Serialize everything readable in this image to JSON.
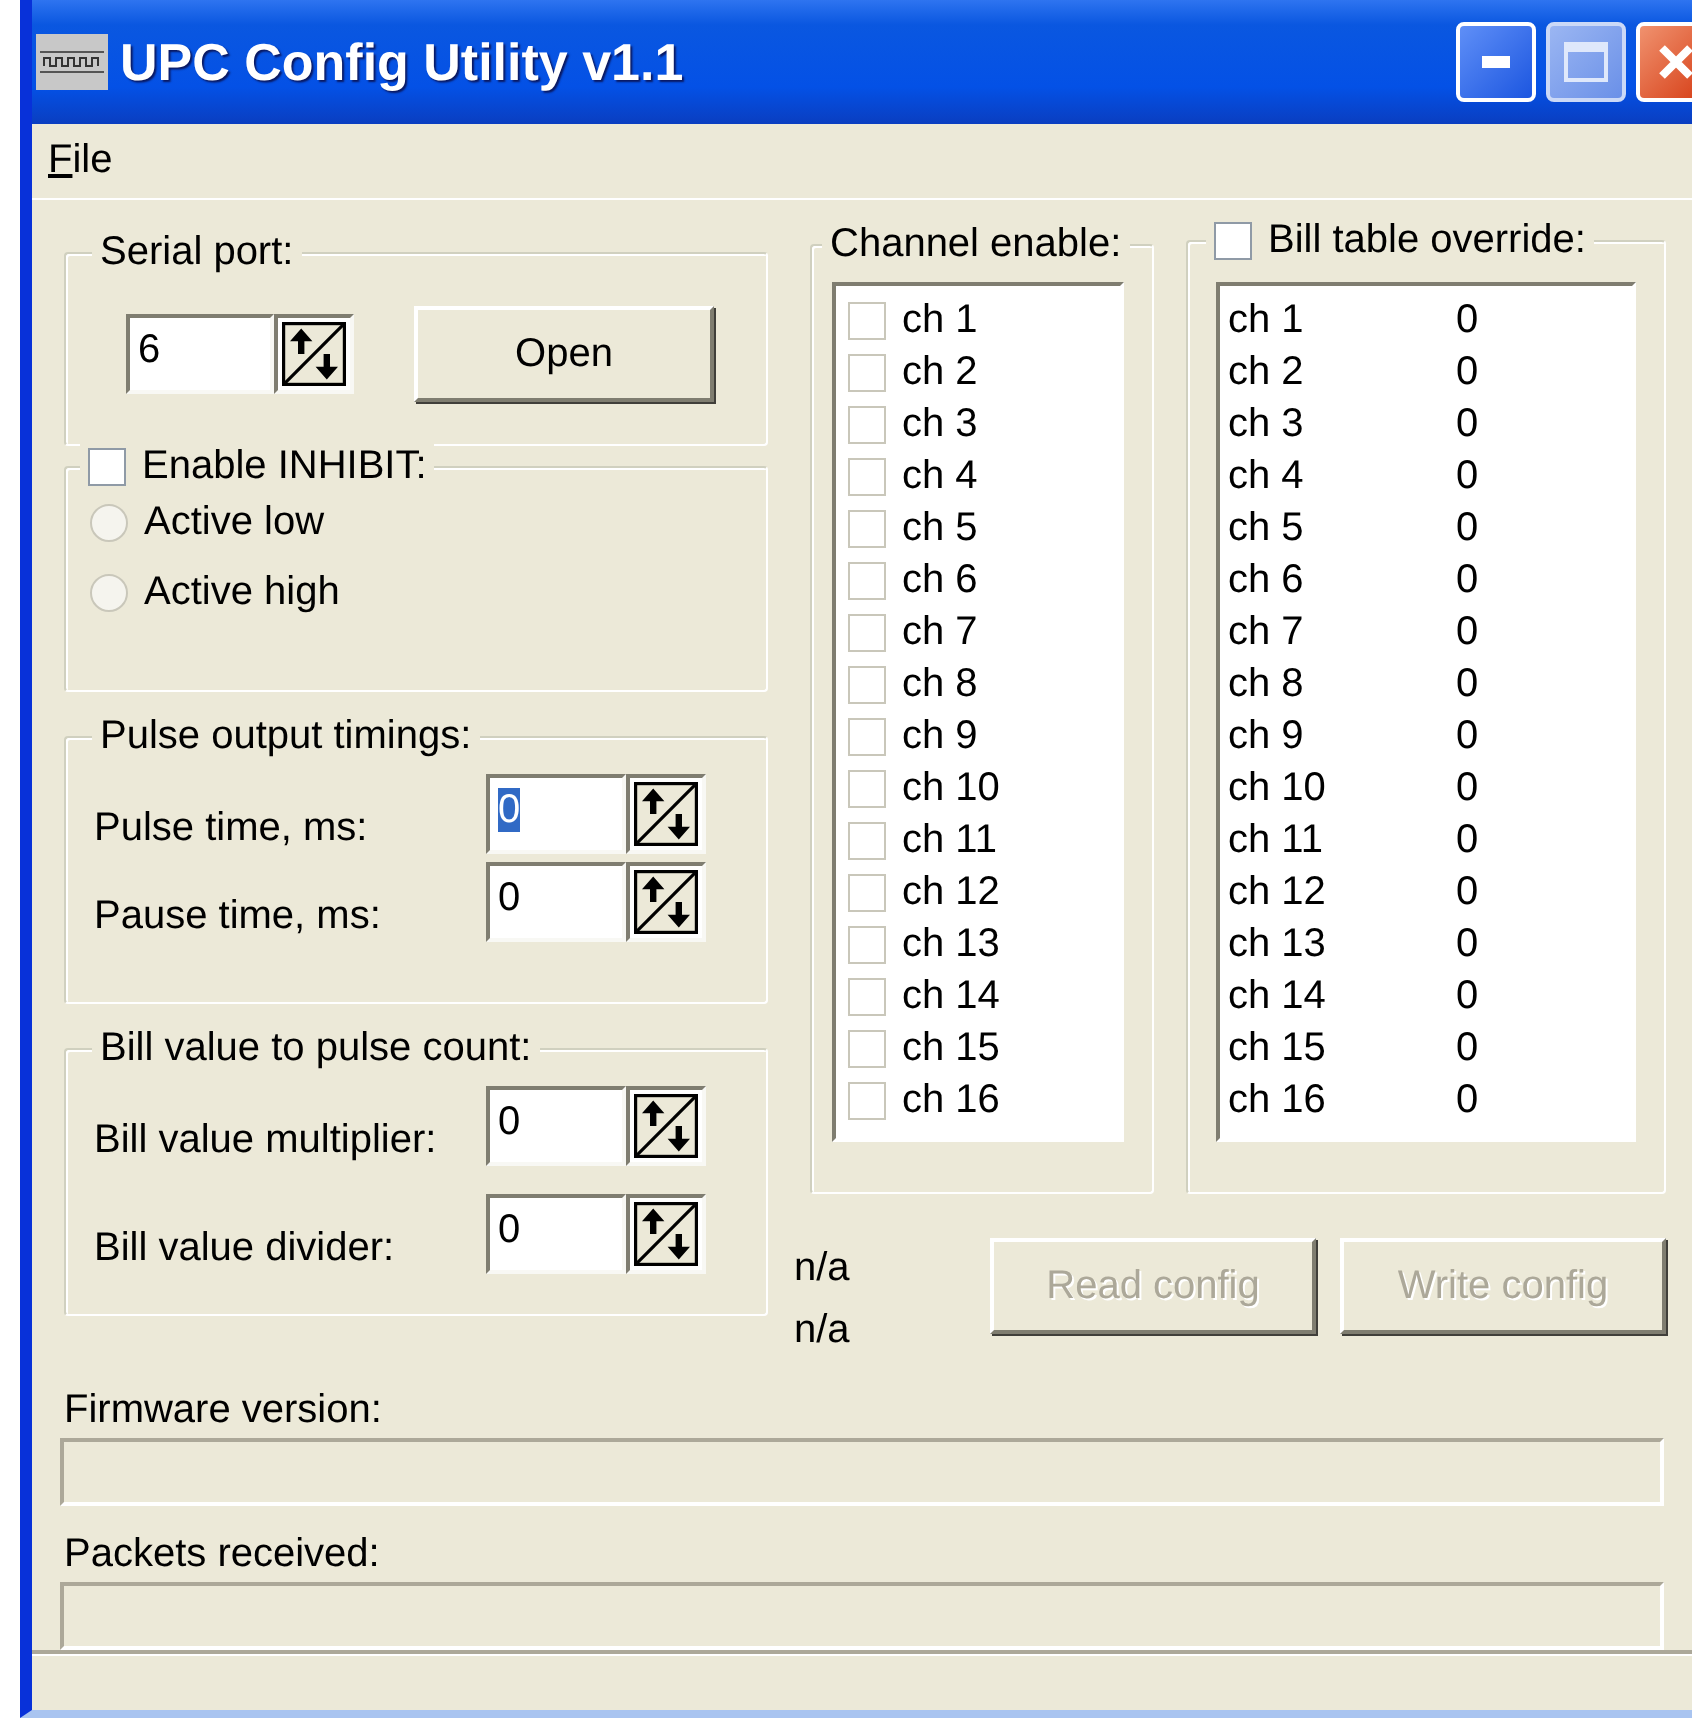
{
  "window": {
    "title": "UPC Config Utility v1.1"
  },
  "menu": [
    {
      "label": "File"
    }
  ],
  "serial_port": {
    "title": "Serial port:",
    "value": "6",
    "button": "Open"
  },
  "inhibit": {
    "title": "Enable INHIBIT:",
    "checked": false,
    "options": [
      {
        "label": "Active low",
        "selected": false
      },
      {
        "label": "Active high",
        "selected": false
      }
    ]
  },
  "pulse_timings": {
    "title": "Pulse output timings:",
    "fields": [
      {
        "label": "Pulse time, ms:",
        "value": "0",
        "focused": true
      },
      {
        "label": "Pause time, ms:",
        "value": "0",
        "focused": false
      }
    ]
  },
  "bill_value": {
    "title": "Bill value to pulse count:",
    "fields": [
      {
        "label": "Bill value multiplier:",
        "value": "0",
        "focused": false
      },
      {
        "label": "Bill value divider:",
        "value": "0",
        "focused": false
      }
    ]
  },
  "channel_enable": {
    "title": "Channel enable:",
    "channels": [
      {
        "label": "ch 1",
        "checked": false
      },
      {
        "label": "ch 2",
        "checked": false
      },
      {
        "label": "ch 3",
        "checked": false
      },
      {
        "label": "ch 4",
        "checked": false
      },
      {
        "label": "ch 5",
        "checked": false
      },
      {
        "label": "ch 6",
        "checked": false
      },
      {
        "label": "ch 7",
        "checked": false
      },
      {
        "label": "ch 8",
        "checked": false
      },
      {
        "label": "ch 9",
        "checked": false
      },
      {
        "label": "ch 10",
        "checked": false
      },
      {
        "label": "ch 11",
        "checked": false
      },
      {
        "label": "ch 12",
        "checked": false
      },
      {
        "label": "ch 13",
        "checked": false
      },
      {
        "label": "ch 14",
        "checked": false
      },
      {
        "label": "ch 15",
        "checked": false
      },
      {
        "label": "ch 16",
        "checked": false
      }
    ]
  },
  "bill_table": {
    "title": "Bill table override:",
    "checked": false,
    "rows": [
      {
        "channel": "ch 1",
        "value": "0"
      },
      {
        "channel": "ch 2",
        "value": "0"
      },
      {
        "channel": "ch 3",
        "value": "0"
      },
      {
        "channel": "ch 4",
        "value": "0"
      },
      {
        "channel": "ch 5",
        "value": "0"
      },
      {
        "channel": "ch 6",
        "value": "0"
      },
      {
        "channel": "ch 7",
        "value": "0"
      },
      {
        "channel": "ch 8",
        "value": "0"
      },
      {
        "channel": "ch 9",
        "value": "0"
      },
      {
        "channel": "ch 10",
        "value": "0"
      },
      {
        "channel": "ch 11",
        "value": "0"
      },
      {
        "channel": "ch 12",
        "value": "0"
      },
      {
        "channel": "ch 13",
        "value": "0"
      },
      {
        "channel": "ch 14",
        "value": "0"
      },
      {
        "channel": "ch 15",
        "value": "0"
      },
      {
        "channel": "ch 16",
        "value": "0"
      }
    ]
  },
  "status_labels": [
    "n/a",
    "n/a"
  ],
  "buttons": [
    {
      "label": "Read config",
      "disabled": true
    },
    {
      "label": "Write config",
      "disabled": true
    }
  ],
  "firmware": {
    "label": "Firmware version:"
  },
  "packets": {
    "label": "Packets received:"
  }
}
